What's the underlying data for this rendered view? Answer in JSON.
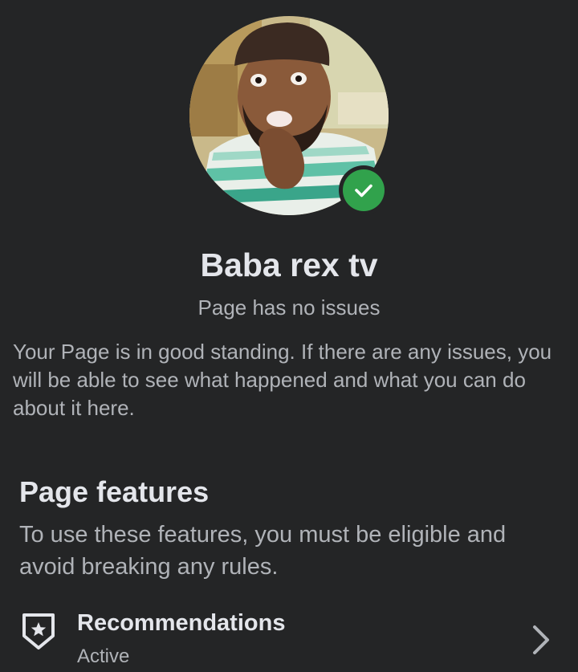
{
  "profile": {
    "name": "Baba rex tv",
    "status": "Page has no issues",
    "description": "Your Page is in good standing. If there are any issues, you will be able to see what happened and what you can do about it here.",
    "verified_color": "#31a24c"
  },
  "features": {
    "title": "Page features",
    "description": "To use these features, you must be eligible and avoid breaking any rules.",
    "items": [
      {
        "label": "Recommendations",
        "status": "Active",
        "icon": "shield-star-icon"
      }
    ]
  },
  "colors": {
    "background": "#242526",
    "primary_text": "#e4e6eb",
    "secondary_text": "#b0b3b8",
    "success": "#31a24c"
  }
}
